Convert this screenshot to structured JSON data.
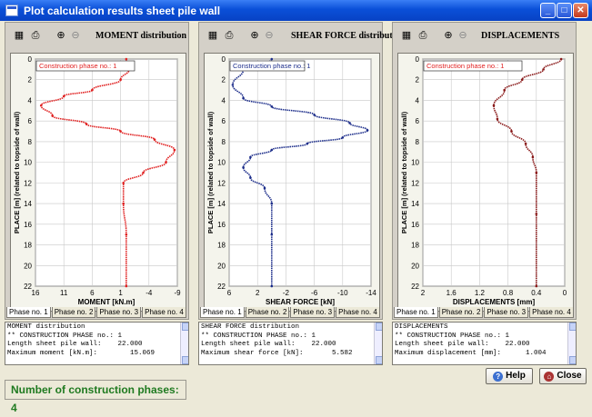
{
  "window": {
    "title": "Plot calculation results sheet pile wall"
  },
  "panels": [
    {
      "title": "MOMENT distribution",
      "legend": "Construction phase no.: 1",
      "xlabel": "MOMENT [kN.m]",
      "ylabel": "PLACE [m] (related to topside of wall)",
      "xticks": [
        "16",
        "11",
        "6",
        "1",
        "-4",
        "-9"
      ],
      "color": "#e02020",
      "info": "MOMENT distribution\n** CONSTRUCTION PHASE no.: 1\nLength sheet pile wall:    22.000\nMaximum moment [kN.m]:        15.069"
    },
    {
      "title": "SHEAR FORCE distribution",
      "legend": "Construction phase no.: 1",
      "xlabel": "SHEAR FORCE [kN]",
      "ylabel": "PLACE [m] (related to topside of wall)",
      "xticks": [
        "6",
        "2",
        "-2",
        "-6",
        "-10",
        "-14"
      ],
      "color": "#1c2d8a",
      "info": "SHEAR FORCE distribution\n** CONSTRUCTION PHASE no.: 1\nLength sheet pile wall:    22.000\nMaximum shear force [kN]:       5.582"
    },
    {
      "title": "DISPLACEMENTS",
      "legend": "Construction phase no.: 1",
      "xlabel": "DISPLACEMENTS [mm]",
      "ylabel": "PLACE [m] (related to topside of wall)",
      "xticks": [
        "2",
        "1.6",
        "1.2",
        "0.8",
        "0.4",
        "0"
      ],
      "color": "#8a1a1a",
      "info": "DISPLACEMENTS\n** CONSTRUCTION PHASE no.: 1\nLength sheet pile wall:    22.000\nMaximum displacement [mm]:      1.004"
    }
  ],
  "yticks": [
    "0",
    "2",
    "4",
    "6",
    "8",
    "10",
    "12",
    "14",
    "16",
    "18",
    "20",
    "22"
  ],
  "tabs": [
    "Phase no. 1",
    "Phase no. 2",
    "Phase no. 3",
    "Phase no. 4"
  ],
  "status": "Number of construction phases: 4",
  "buttons": {
    "help": "Help",
    "close": "Close"
  },
  "chart_data": [
    {
      "type": "line",
      "title": "MOMENT distribution",
      "xlabel": "MOMENT [kN.m]",
      "ylabel": "PLACE [m] (related to topside of wall)",
      "xlim": [
        16,
        -9
      ],
      "ylim": [
        0,
        22
      ],
      "series": [
        {
          "name": "Construction phase no.: 1",
          "x": [
            0,
            -0.5,
            1,
            6,
            11,
            15,
            13,
            7,
            1,
            -5,
            -8.5,
            -7,
            -3,
            0.5,
            0.5,
            0,
            0
          ],
          "y": [
            0,
            1,
            2,
            3,
            3.6,
            4.5,
            5.5,
            6.3,
            7,
            7.8,
            8.8,
            10,
            11,
            12,
            14,
            17,
            22
          ]
        }
      ]
    },
    {
      "type": "line",
      "title": "SHEAR FORCE distribution",
      "xlabel": "SHEAR FORCE [kN]",
      "ylabel": "PLACE [m] (related to topside of wall)",
      "xlim": [
        6,
        -14
      ],
      "ylim": [
        0,
        22
      ],
      "series": [
        {
          "name": "Construction phase no.: 1",
          "x": [
            0,
            4,
            5.5,
            4,
            0,
            -6,
            -11,
            -13.5,
            -10,
            -5,
            0,
            3,
            4,
            3,
            1,
            0,
            0,
            0
          ],
          "y": [
            0,
            1,
            2.5,
            3.8,
            4.6,
            5.4,
            6.2,
            6.9,
            7.6,
            8.2,
            8.8,
            9.5,
            10.5,
            11.5,
            12.5,
            14,
            17,
            22
          ]
        }
      ]
    },
    {
      "type": "line",
      "title": "DISPLACEMENTS",
      "xlabel": "DISPLACEMENTS [mm]",
      "ylabel": "PLACE [m] (related to topside of wall)",
      "xlim": [
        2,
        0
      ],
      "ylim": [
        0,
        22
      ],
      "series": [
        {
          "name": "Construction phase no.: 1",
          "x": [
            0.05,
            0.3,
            0.6,
            0.85,
            1.0,
            0.95,
            0.75,
            0.55,
            0.45,
            0.4,
            0.4,
            0.4
          ],
          "y": [
            0,
            1,
            2,
            3,
            4.5,
            5.8,
            7,
            8.2,
            9.5,
            11,
            15,
            22
          ]
        }
      ]
    }
  ]
}
